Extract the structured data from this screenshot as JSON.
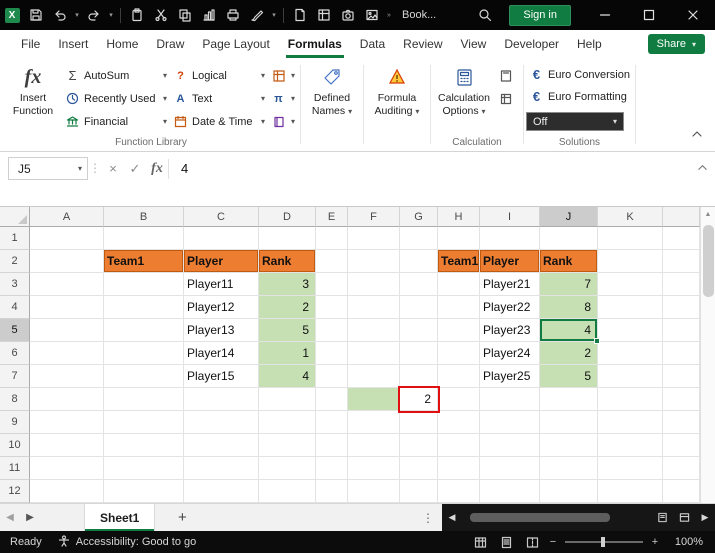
{
  "titlebar": {
    "workbook_name": "Book...",
    "signin_label": "Sign in"
  },
  "tabs": {
    "items": [
      "File",
      "Insert",
      "Home",
      "Draw",
      "Page Layout",
      "Formulas",
      "Data",
      "Review",
      "View",
      "Developer",
      "Help"
    ],
    "active": "Formulas",
    "share_label": "Share"
  },
  "ribbon": {
    "insert_function": "Insert Function",
    "autosum": "AutoSum",
    "recently_used": "Recently Used",
    "financial": "Financial",
    "logical": "Logical",
    "text": "Text",
    "date_time": "Date & Time",
    "defined_names": "Defined Names",
    "formula_auditing": "Formula Auditing",
    "calculation_options": "Calculation Options",
    "euro_conversion": "Euro Conversion",
    "euro_formatting": "Euro Formatting",
    "solutions_dropdown": "Off",
    "groups": {
      "function_library": "Function Library",
      "calculation": "Calculation",
      "solutions": "Solutions"
    }
  },
  "formula_bar": {
    "name_box": "J5",
    "value": "4"
  },
  "grid": {
    "columns": [
      "A",
      "B",
      "C",
      "D",
      "E",
      "F",
      "G",
      "H",
      "I",
      "J",
      "K"
    ],
    "rows": [
      "1",
      "2",
      "3",
      "4",
      "5",
      "6",
      "7",
      "8",
      "9",
      "10",
      "11",
      "12"
    ],
    "selection": {
      "cell": "J5",
      "column": "J",
      "row": "5"
    },
    "red_box_cell": "G8",
    "cells": {
      "B2": {
        "text": "Team1",
        "kind": "header"
      },
      "C2": {
        "text": "Player",
        "kind": "header"
      },
      "D2": {
        "text": "Rank",
        "kind": "header"
      },
      "C3": {
        "text": "Player11",
        "kind": "name"
      },
      "D3": {
        "text": "3",
        "kind": "rank"
      },
      "C4": {
        "text": "Player12",
        "kind": "name"
      },
      "D4": {
        "text": "2",
        "kind": "rank"
      },
      "C5": {
        "text": "Player13",
        "kind": "name"
      },
      "D5": {
        "text": "5",
        "kind": "rank"
      },
      "C6": {
        "text": "Player14",
        "kind": "name"
      },
      "D6": {
        "text": "1",
        "kind": "rank"
      },
      "C7": {
        "text": "Player15",
        "kind": "name"
      },
      "D7": {
        "text": "4",
        "kind": "rank"
      },
      "H2": {
        "text": "Team1",
        "kind": "header"
      },
      "I2": {
        "text": "Player",
        "kind": "header"
      },
      "J2": {
        "text": "Rank",
        "kind": "header"
      },
      "I3": {
        "text": "Player21",
        "kind": "name"
      },
      "J3": {
        "text": "7",
        "kind": "rank"
      },
      "I4": {
        "text": "Player22",
        "kind": "name"
      },
      "J4": {
        "text": "8",
        "kind": "rank"
      },
      "I5": {
        "text": "Player23",
        "kind": "name"
      },
      "J5": {
        "text": "4",
        "kind": "rank"
      },
      "I6": {
        "text": "Player24",
        "kind": "name"
      },
      "J6": {
        "text": "2",
        "kind": "rank"
      },
      "I7": {
        "text": "Player25",
        "kind": "name"
      },
      "J7": {
        "text": "5",
        "kind": "rank"
      },
      "F8": {
        "text": "",
        "kind": "fill"
      },
      "G8": {
        "text": "2",
        "kind": "result"
      }
    }
  },
  "sheet_bar": {
    "active_sheet": "Sheet1"
  },
  "status_bar": {
    "mode": "Ready",
    "accessibility": "Accessibility: Good to go",
    "zoom": "100%"
  },
  "colors": {
    "accent_green": "#107C41",
    "table_header_orange": "#ED7D31",
    "rank_cell_green": "#C6E0B4",
    "annotation_red": "#E01010",
    "titlebar_black": "#0C0C0C"
  }
}
